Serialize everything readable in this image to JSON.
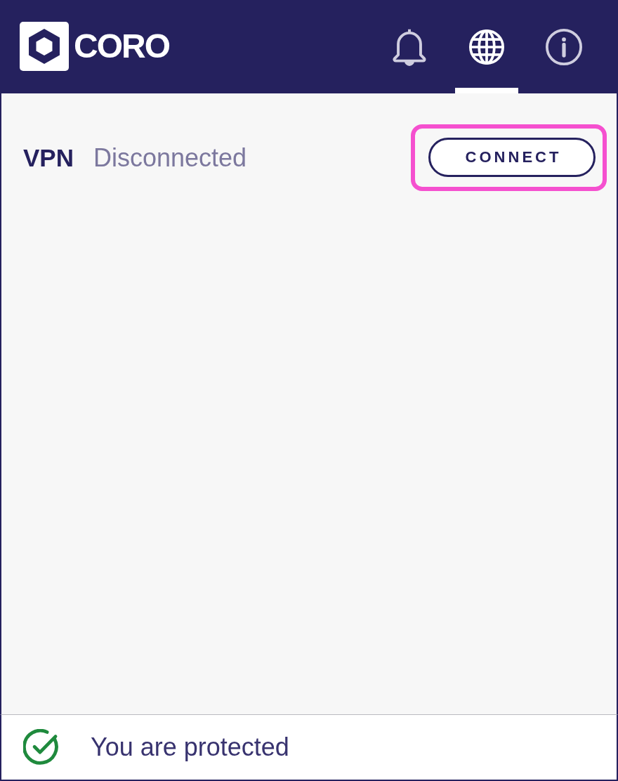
{
  "header": {
    "logo": "CORO",
    "tabs": [
      {
        "kind": "bell",
        "selected": false
      },
      {
        "kind": "globe",
        "selected": true
      },
      {
        "kind": "info",
        "selected": false
      }
    ]
  },
  "vpn": {
    "label": "VPN",
    "status": "Disconnected",
    "button": {
      "label": "CONNECT",
      "highlighted": true
    }
  },
  "status_bar": {
    "text": "You are protected",
    "protected": true
  }
}
